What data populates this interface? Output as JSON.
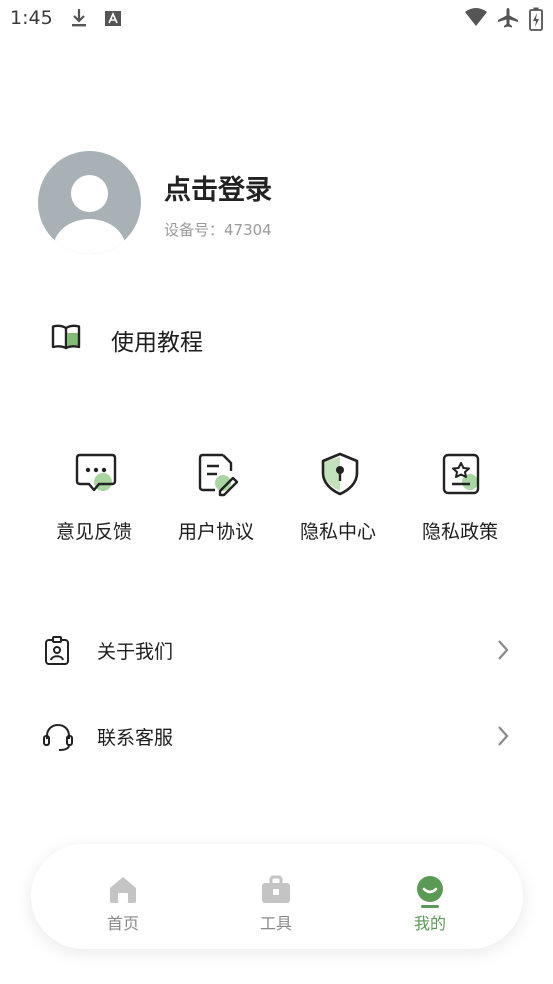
{
  "status_bar": {
    "time": "1:45",
    "icons": [
      "download-icon",
      "keyboard-icon",
      "wifi-icon",
      "airplane-icon",
      "battery-charging-icon"
    ]
  },
  "profile": {
    "login_label": "点击登录",
    "device_id": "设备号：47304"
  },
  "tutorial": {
    "label": "使用教程",
    "icon": "book-icon"
  },
  "grid_items": [
    {
      "label": "意见反馈",
      "icon": "feedback-chat-icon"
    },
    {
      "label": "用户协议",
      "icon": "document-edit-icon"
    },
    {
      "label": "隐私中心",
      "icon": "shield-lock-icon"
    },
    {
      "label": "隐私政策",
      "icon": "policy-badge-icon"
    }
  ],
  "list_items": [
    {
      "label": "关于我们",
      "icon": "id-badge-icon"
    },
    {
      "label": "联系客服",
      "icon": "headset-icon"
    }
  ],
  "bottom_nav": [
    {
      "label": "首页",
      "icon": "home-icon",
      "active": false
    },
    {
      "label": "工具",
      "icon": "toolbox-icon",
      "active": false
    },
    {
      "label": "我的",
      "icon": "smile-profile-icon",
      "active": true
    }
  ],
  "colors": {
    "accent_green": "#5a9a55",
    "light_green": "#8fc486",
    "avatar_gray": "#a8b1b6",
    "inactive_gray": "#c4c4c4"
  }
}
